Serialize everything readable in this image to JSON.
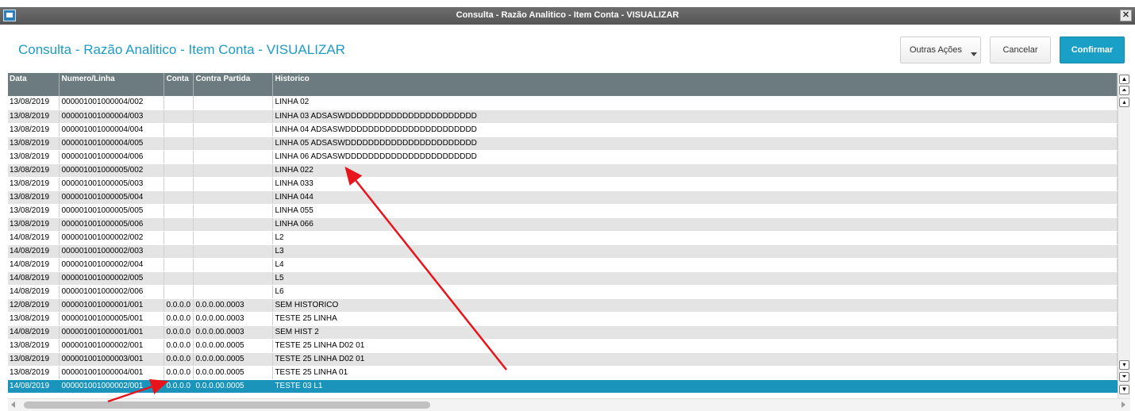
{
  "window": {
    "title": "Consulta - Razão Analitico - Item Conta - VISUALIZAR"
  },
  "header": {
    "title": "Consulta - Razão Analitico - Item Conta - VISUALIZAR",
    "buttons": {
      "outras": "Outras Ações",
      "cancelar": "Cancelar",
      "confirmar": "Confirmar"
    }
  },
  "grid": {
    "columns": [
      "Data",
      "Numero/Linha",
      "Conta",
      "Contra Partida",
      "Historico"
    ],
    "rows": [
      [
        "13/08/2019",
        "000001001000004/002",
        "",
        "",
        "LINHA 02"
      ],
      [
        "13/08/2019",
        "000001001000004/003",
        "",
        "",
        "LINHA 03  ADSASWDDDDDDDDDDDDDDDDDDDDDDD"
      ],
      [
        "13/08/2019",
        "000001001000004/004",
        "",
        "",
        "LINHA 04 ADSASWDDDDDDDDDDDDDDDDDDDDDDD"
      ],
      [
        "13/08/2019",
        "000001001000004/005",
        "",
        "",
        "LINHA 05  ADSASWDDDDDDDDDDDDDDDDDDDDDDD"
      ],
      [
        "13/08/2019",
        "000001001000004/006",
        "",
        "",
        "LINHA 06 ADSASWDDDDDDDDDDDDDDDDDDDDDDD"
      ],
      [
        "13/08/2019",
        "000001001000005/002",
        "",
        "",
        "LINHA 022"
      ],
      [
        "13/08/2019",
        "000001001000005/003",
        "",
        "",
        "LINHA 033"
      ],
      [
        "13/08/2019",
        "000001001000005/004",
        "",
        "",
        "LINHA 044"
      ],
      [
        "13/08/2019",
        "000001001000005/005",
        "",
        "",
        "LINHA 055"
      ],
      [
        "13/08/2019",
        "000001001000005/006",
        "",
        "",
        "LINHA 066"
      ],
      [
        "14/08/2019",
        "000001001000002/002",
        "",
        "",
        "L2"
      ],
      [
        "14/08/2019",
        "000001001000002/003",
        "",
        "",
        "L3"
      ],
      [
        "14/08/2019",
        "000001001000002/004",
        "",
        "",
        "L4"
      ],
      [
        "14/08/2019",
        "000001001000002/005",
        "",
        "",
        "L5"
      ],
      [
        "14/08/2019",
        "000001001000002/006",
        "",
        "",
        "L6"
      ],
      [
        "12/08/2019",
        "000001001000001/001",
        "0.0.0.0",
        "0.0.0.00.0003",
        "SEM HISTORICO"
      ],
      [
        "13/08/2019",
        "000001001000005/001",
        "0.0.0.0",
        "0.0.0.00.0003",
        "TESTE 25 LINHA"
      ],
      [
        "14/08/2019",
        "000001001000001/001",
        "0.0.0.0",
        "0.0.0.00.0003",
        "SEM HIST 2"
      ],
      [
        "13/08/2019",
        "000001001000002/001",
        "0.0.0.0",
        "0.0.0.00.0005",
        "TESTE 25 LINHA  D02   01"
      ],
      [
        "13/08/2019",
        "000001001000003/001",
        "0.0.0.0",
        "0.0.0.00.0005",
        "TESTE 25 LINHA  D02   01"
      ],
      [
        "13/08/2019",
        "000001001000004/001",
        "0.0.0.0",
        "0.0.0.00.0005",
        "TESTE 25 LINHA  01"
      ],
      [
        "14/08/2019",
        "000001001000002/001",
        "0.0.0.0",
        "0.0.0.00.0005",
        "TESTE 03 L1"
      ]
    ],
    "selected_index": 21
  },
  "icons": {
    "app": "window-app-icon",
    "close": "close-icon",
    "scroll_top": "scroll-top-icon",
    "scroll_page_up": "scroll-page-up-icon",
    "scroll_up": "scroll-up-icon",
    "scroll_down": "scroll-down-icon",
    "scroll_page_down": "scroll-page-down-icon",
    "scroll_bottom": "scroll-bottom-icon"
  },
  "annotation_color": "#e8141b"
}
